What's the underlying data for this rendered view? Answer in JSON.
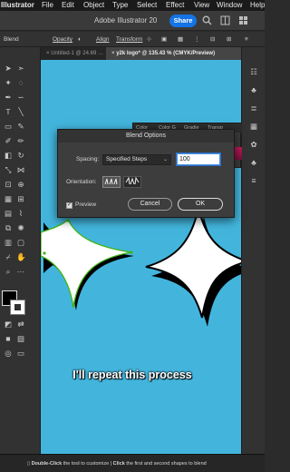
{
  "menu_bar": {
    "items": [
      "Illustrator",
      "File",
      "Edit",
      "Object",
      "Type",
      "Select",
      "Effect",
      "View",
      "Window",
      "Help"
    ]
  },
  "app_bar": {
    "title": "Adobe Illustrator 20",
    "share_label": "Share"
  },
  "control_bar": {
    "mode_label": "Blend",
    "opacity_label": "Opacity",
    "align_label": "Align",
    "transform_label": "Transform"
  },
  "tabs": [
    {
      "label": "Untitled-1 @ 24.69 …",
      "active": false
    },
    {
      "label": "y2k logo* @ 135.43 % (CMYK/Preview)",
      "active": true
    }
  ],
  "color_panel": {
    "tabs": [
      "Color",
      "Color G",
      "Gradie",
      "Transp"
    ]
  },
  "dialog": {
    "title": "Blend Options",
    "spacing_label": "Spacing:",
    "spacing_value": "Specified Steps",
    "steps_value": "100",
    "orientation_label": "Orientation:",
    "orientation_icon_1": "align-to-page-icon",
    "orientation_icon_2": "align-to-path-icon",
    "preview_label": "Preview",
    "preview_checked": true,
    "cancel_label": "Cancel",
    "ok_label": "OK"
  },
  "caption": "I'll repeat this process",
  "status_bar": {
    "hint_key_1": "Double-Click",
    "hint_text_1": "the tool to customize",
    "hint_key_2": "Click",
    "hint_text_2": "the first and second shapes to blend"
  },
  "colors": {
    "canvas": "#43b5dd",
    "accent": "#1473e6",
    "selection": "#3fb618"
  }
}
